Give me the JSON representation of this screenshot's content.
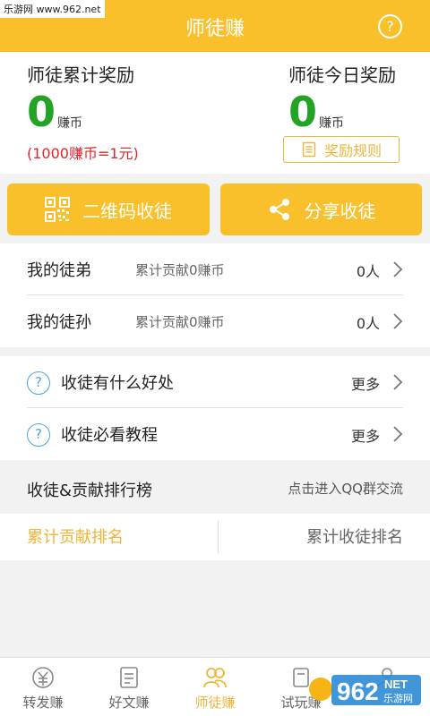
{
  "watermark": "乐游网 www.962.net",
  "header": {
    "title": "师徒赚",
    "help_icon": "question-circle-icon",
    "help_glyph": "?"
  },
  "stats": {
    "total": {
      "label": "师徒累计奖励",
      "value": "0",
      "unit": "赚币"
    },
    "today": {
      "label": "师徒今日奖励",
      "value": "0",
      "unit": "赚币"
    },
    "rate": "(1000赚币=1元)",
    "rules_button": "奖励规则"
  },
  "actions": {
    "qr_label": "二维码收徒",
    "share_label": "分享收徒"
  },
  "disciples": [
    {
      "label": "我的徒弟",
      "contribution": "累计贡献0赚币",
      "count": "0人"
    },
    {
      "label": "我的徒孙",
      "contribution": "累计贡献0赚币",
      "count": "0人"
    }
  ],
  "tips": [
    {
      "label": "收徒有什么好处",
      "more": "更多"
    },
    {
      "label": "收徒必看教程",
      "more": "更多"
    }
  ],
  "ranking": {
    "title": "收徒&贡献排行榜",
    "qq_link": "点击进入QQ群交流",
    "tab_contribution": "累计贡献排名",
    "tab_recruit": "累计收徒排名"
  },
  "bottom_nav": [
    {
      "label": "转发赚",
      "icon": "yuan-coin-icon",
      "active": false
    },
    {
      "label": "好文赚",
      "icon": "document-icon",
      "active": false
    },
    {
      "label": "师徒赚",
      "icon": "people-icon",
      "active": true
    },
    {
      "label": "试玩赚",
      "icon": "game-icon",
      "active": false
    },
    {
      "label": "",
      "icon": "profile-icon",
      "active": false
    }
  ],
  "overlay_logo": {
    "text": "962",
    "sub": "NET",
    "cn": "乐游网"
  },
  "colors": {
    "brand": "#f9c02c",
    "accent": "#f0b43a",
    "green": "#22a323",
    "red": "#e0262b",
    "info": "#4aa6d8"
  }
}
